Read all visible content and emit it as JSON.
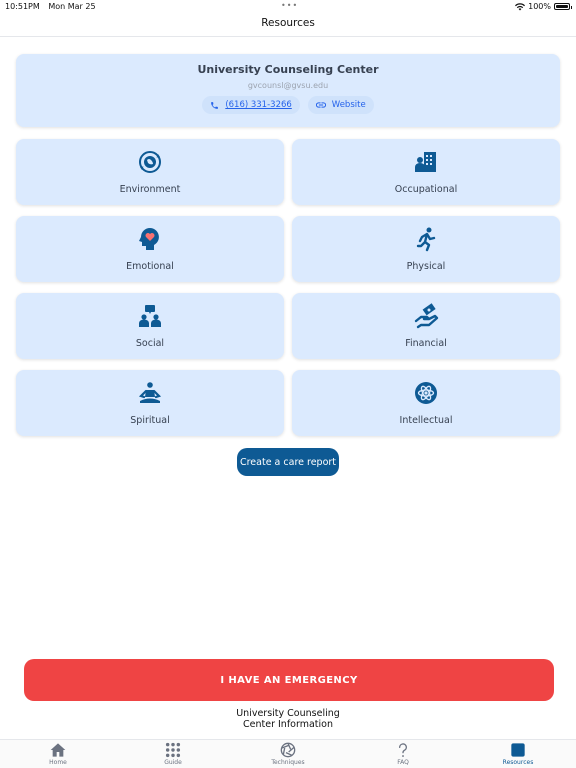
{
  "status": {
    "time": "10:51PM",
    "date": "Mon Mar 25",
    "battery_text": "100%",
    "battery_level": 1.0
  },
  "header": {
    "title": "Resources"
  },
  "center": {
    "name": "University Counseling Center",
    "email": "gvcounsl@gvsu.edu",
    "phone": "(616) 331-3266",
    "website_label": "Website"
  },
  "tiles": [
    {
      "label": "Environment",
      "icon": "globe-refresh-icon"
    },
    {
      "label": "Occupational",
      "icon": "office-worker-icon"
    },
    {
      "label": "Emotional",
      "icon": "head-heart-icon"
    },
    {
      "label": "Physical",
      "icon": "running-person-icon"
    },
    {
      "label": "Social",
      "icon": "people-chat-icon"
    },
    {
      "label": "Financial",
      "icon": "hand-money-icon"
    },
    {
      "label": "Spiritual",
      "icon": "meditation-icon"
    },
    {
      "label": "Intellectual",
      "icon": "atom-icon"
    }
  ],
  "care_report_label": "Create a care report",
  "emergency_label": "I HAVE AN EMERGENCY",
  "footer": {
    "line1": "University Counseling",
    "line2": "Center Information"
  },
  "tabbar": {
    "items": [
      {
        "label": "Home",
        "icon": "home-icon"
      },
      {
        "label": "Guide",
        "icon": "grid-icon"
      },
      {
        "label": "Techniques",
        "icon": "aperture-icon"
      },
      {
        "label": "FAQ",
        "icon": "question-icon"
      },
      {
        "label": "Resources",
        "icon": "square-icon"
      }
    ],
    "active": "Resources"
  },
  "colors": {
    "accent": "#0e5a94",
    "card_bg": "#dbeafe",
    "emergency": "#ef4444",
    "link": "#2563eb"
  }
}
